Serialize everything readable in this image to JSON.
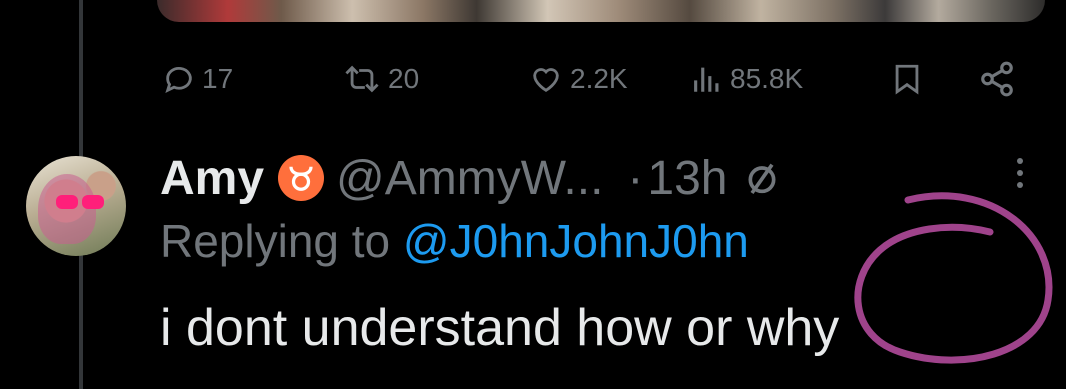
{
  "actions": {
    "replies": "17",
    "reposts": "20",
    "likes": "2.2K",
    "views": "85.8K"
  },
  "reply_tweet": {
    "name": "Amy",
    "handle": "@AmmyW...",
    "separator": "·",
    "time": "13h",
    "replying_prefix": "Replying to",
    "replying_to": "@J0hnJohnJ0hn",
    "text": "i dont understand how or why"
  },
  "icons": {
    "reply": "reply-icon",
    "repost": "repost-icon",
    "like": "heart-icon",
    "views": "views-icon",
    "bookmark": "bookmark-icon",
    "share": "share-icon",
    "zodiac": "taurus-icon",
    "muted": "circle-slash-icon",
    "more": "more-icon"
  },
  "colors": {
    "background": "#000000",
    "text": "#e7e9ea",
    "secondary": "#71767b",
    "link": "#1d9bf0",
    "zodiac_badge": "#ff6f3c",
    "annotation": "#b04a9a"
  }
}
